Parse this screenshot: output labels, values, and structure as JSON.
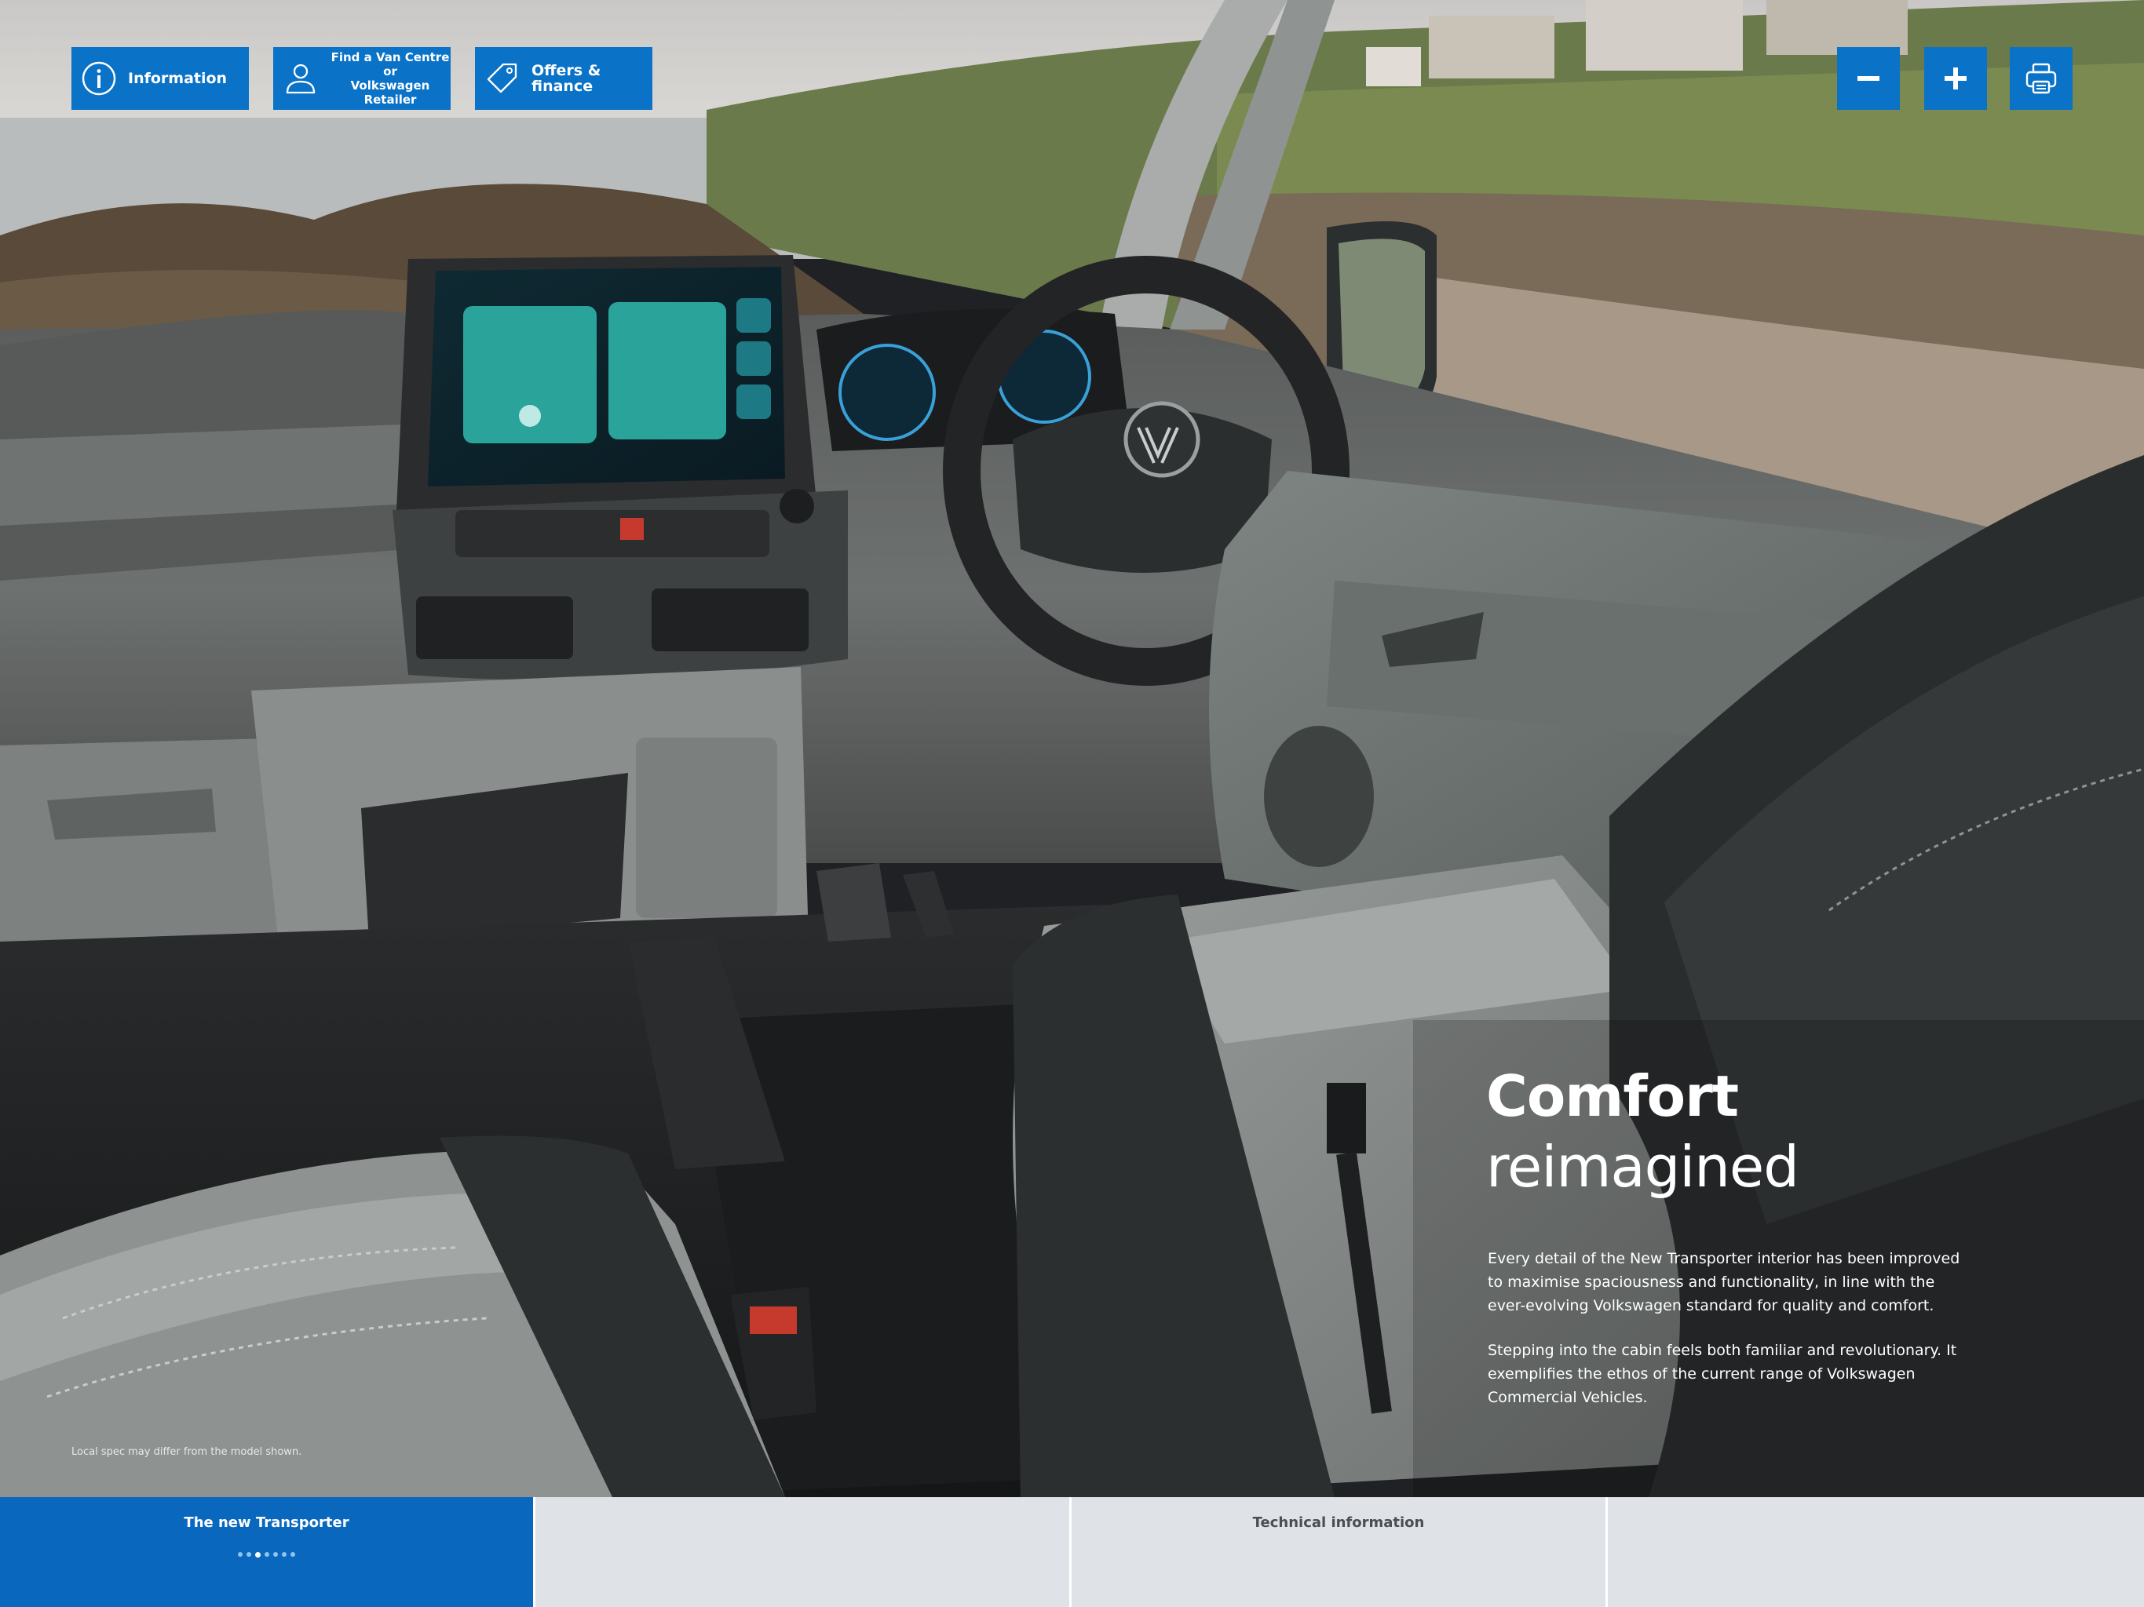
{
  "toolbar": {
    "information_label": "Information",
    "find_label_line1": "Find a Van Centre or",
    "find_label_line2": "Volkswagen Retailer",
    "offers_label": "Offers & finance",
    "zoom_out_icon": "minus-icon",
    "zoom_in_icon": "plus-icon",
    "print_icon": "printer-icon",
    "accent_color": "#0a72c7"
  },
  "content": {
    "title": "Comfort",
    "subtitle": "reimagined",
    "paragraph1": "Every detail of the New Transporter interior has been improved to maximise spaciousness and functionality, in line with the ever-evolving Volkswagen standard for quality and comfort.",
    "paragraph2": "Stepping into the cabin feels both familiar and revolutionary. It exemplifies the ethos of the current range of Volkswagen Commercial Vehicles.",
    "disclaimer": "Local spec may differ from the model shown."
  },
  "bottom_nav": {
    "tabs": [
      {
        "label": "The new Transporter",
        "active": true
      },
      {
        "label": "",
        "active": false
      },
      {
        "label": "Technical information",
        "active": false
      },
      {
        "label": "",
        "active": false
      }
    ],
    "page_dots": 7,
    "current_dot": 3
  }
}
